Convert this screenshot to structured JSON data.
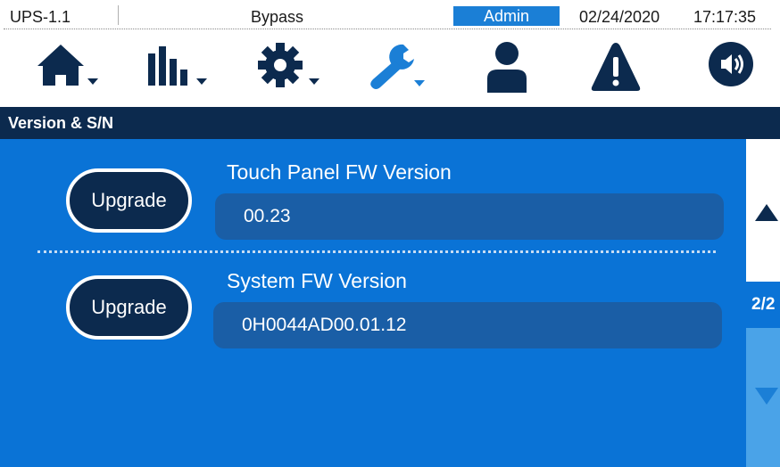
{
  "status_bar": {
    "device": "UPS-1.1",
    "mode": "Bypass",
    "user": "Admin",
    "date": "02/24/2020",
    "time": "17:17:35"
  },
  "toolbar": {
    "items": [
      {
        "icon": "home-icon",
        "has_dropdown": true
      },
      {
        "icon": "bar-chart-icon",
        "has_dropdown": true
      },
      {
        "icon": "gear-icon",
        "has_dropdown": true
      },
      {
        "icon": "wrench-icon",
        "has_dropdown": true,
        "active": true
      },
      {
        "icon": "user-icon",
        "has_dropdown": false
      },
      {
        "icon": "warning-icon",
        "has_dropdown": false
      },
      {
        "icon": "speaker-icon",
        "has_dropdown": false
      }
    ]
  },
  "title": "Version & S/N",
  "versions": [
    {
      "label": "Touch Panel FW Version",
      "value": "00.23",
      "button": "Upgrade"
    },
    {
      "label": "System FW Version",
      "value": "0H0044AD00.01.12",
      "button": "Upgrade"
    }
  ],
  "pager": {
    "page": "2/2"
  },
  "colors": {
    "navy": "#0c2a4e",
    "content_blue": "#0a73d6",
    "value_box": "#1a5ea6",
    "accent": "#1b7fd6",
    "pager_down": "#4aa3e8"
  }
}
